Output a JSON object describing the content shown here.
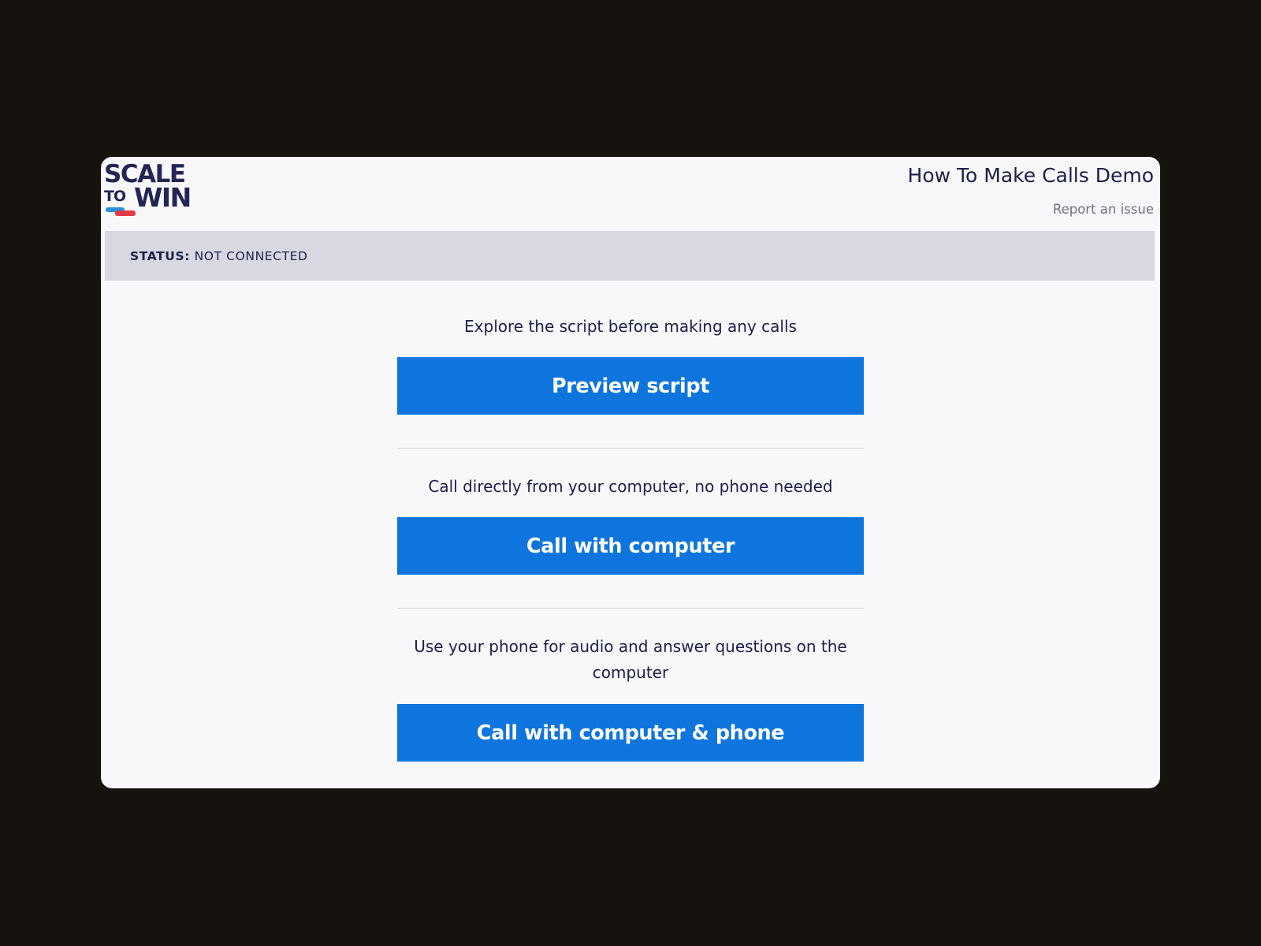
{
  "header": {
    "logo": {
      "line1": "SCALE",
      "line2_small": "TO",
      "line2_large": "WIN",
      "colors": {
        "text": "#232654",
        "bubble_blue": "#2b8fe0",
        "bubble_red": "#e63a4a"
      }
    },
    "title": "How To Make Calls Demo",
    "report_link": "Report an issue"
  },
  "status": {
    "label": "STATUS:",
    "value": "NOT CONNECTED"
  },
  "options": [
    {
      "prompt": "Explore the script before making any calls",
      "button_label": "Preview script"
    },
    {
      "prompt": "Call directly from your computer, no phone needed",
      "button_label": "Call with computer"
    },
    {
      "prompt": "Use your phone for audio and answer questions on the computer",
      "button_label": "Call with computer & phone"
    }
  ],
  "colors": {
    "background": "#16130f",
    "card": "#f8f8fb",
    "status_bar": "#d8d8e3",
    "button": "#0e75de",
    "text": "#1c1f4a"
  }
}
